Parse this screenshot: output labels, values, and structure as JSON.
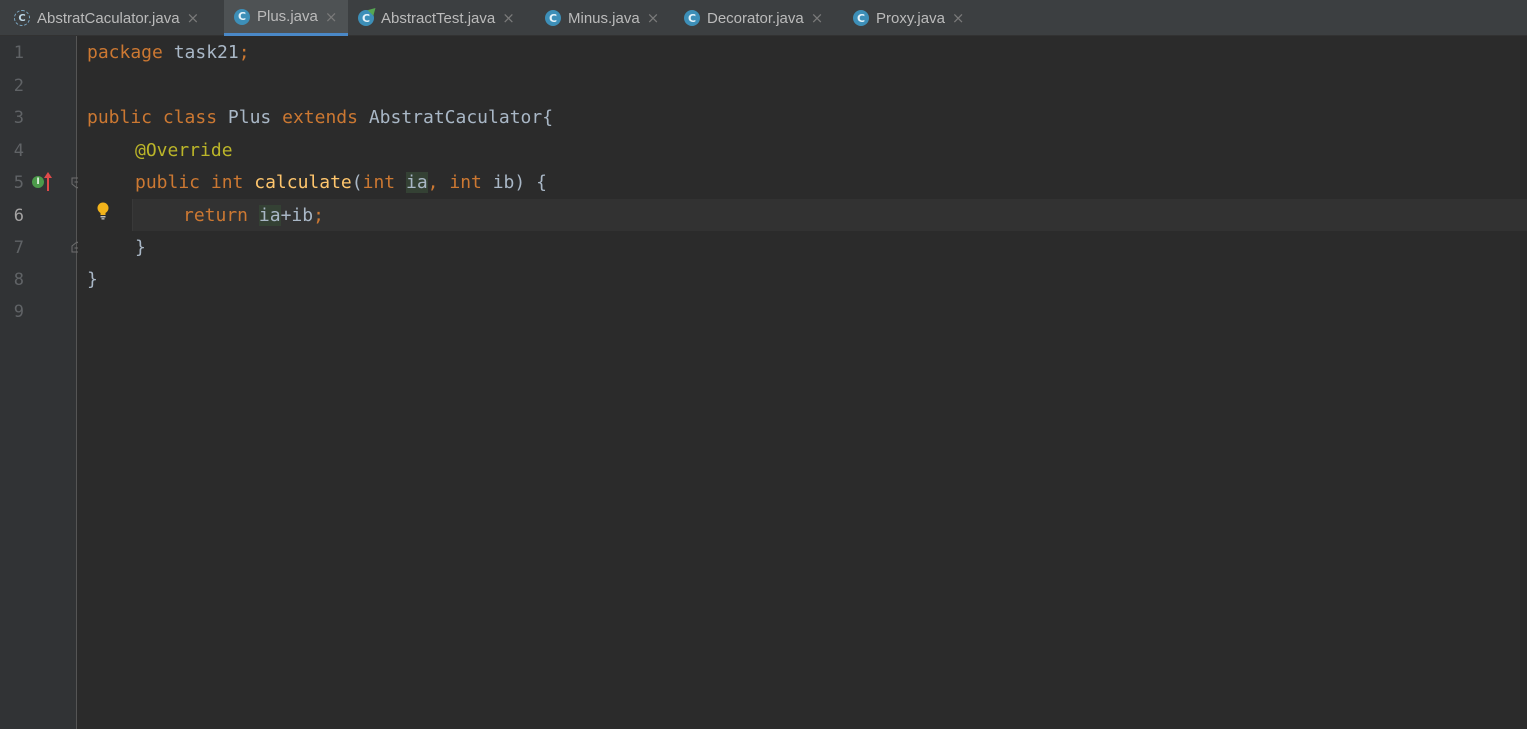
{
  "tabs": [
    {
      "label": "AbstratCaculator.java",
      "icon": "abstract-class-icon",
      "active": false
    },
    {
      "label": "Plus.java",
      "icon": "class-icon",
      "active": true
    },
    {
      "label": "AbstractTest.java",
      "icon": "test-class-icon",
      "active": false
    },
    {
      "label": "Minus.java",
      "icon": "class-icon",
      "active": false
    },
    {
      "label": "Decorator.java",
      "icon": "class-icon",
      "active": false
    },
    {
      "label": "Proxy.java",
      "icon": "class-icon",
      "active": false
    }
  ],
  "tab_icon_glyph": "C",
  "abstract_icon_glyph": "C",
  "close_glyph": "×",
  "gutter": {
    "line_numbers": [
      "1",
      "2",
      "3",
      "4",
      "5",
      "6",
      "7",
      "8",
      "9"
    ],
    "current_line": "6",
    "override_glyph": "I"
  },
  "code": {
    "l1_kw": "package",
    "l1_rest": " task21",
    "l1_semi": ";",
    "l3_kw1": "public",
    "l3_kw2": "class",
    "l3_name": "Plus",
    "l3_kw3": "extends",
    "l3_parent": "AbstratCaculator{",
    "l4_ann": "@Override",
    "l5_kw1": "public",
    "l5_kw2": "int",
    "l5_fn": "calculate",
    "l5_paren": "(",
    "l5_kw3": "int",
    "l5_p1": "ia",
    "l5_comma": ",",
    "l5_kw4": "int",
    "l5_p2": "ib",
    "l5_end": ") {",
    "l6_kw": "return",
    "l6_v1": "ia",
    "l6_rest": "+ib",
    "l6_semi": ";",
    "l7": "}",
    "l8": "}"
  },
  "colors": {
    "keyword": "#cc7832",
    "function": "#ffc66d",
    "annotation": "#bbb529",
    "text": "#a9b7c6",
    "background": "#2b2b2b",
    "tab_accent": "#4a88c7"
  }
}
